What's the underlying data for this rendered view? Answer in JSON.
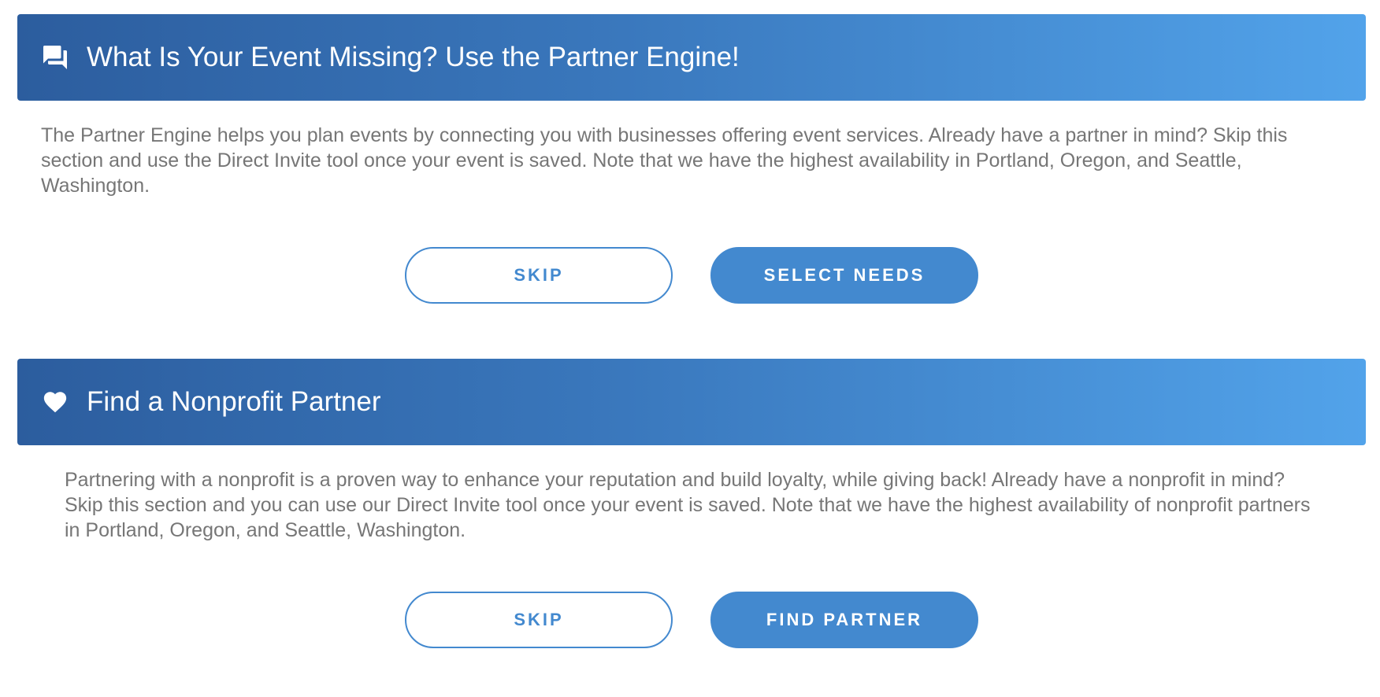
{
  "sections": [
    {
      "icon": "chat-bubbles-icon",
      "title": "What Is Your Event Missing? Use the Partner Engine!",
      "description": "The Partner Engine helps you plan events by connecting you with businesses offering event services. Already have a partner in mind? Skip this section and use the Direct Invite tool once your event is saved. Note that we have the highest availability in Portland, Oregon, and Seattle, Washington.",
      "skip_label": "SKIP",
      "primary_label": "SELECT NEEDS"
    },
    {
      "icon": "heart-icon",
      "title": "Find a Nonprofit Partner",
      "description": "Partnering with a nonprofit is a proven way to enhance your reputation and build loyalty, while giving back! Already have a nonprofit in mind? Skip this section and you can use our Direct Invite tool once your event is saved. Note that we have the highest availability of nonprofit partners in Portland, Oregon, and Seattle, Washington.",
      "skip_label": "SKIP",
      "primary_label": "FIND PARTNER"
    }
  ],
  "colors": {
    "header_gradient_start": "#2c5d9e",
    "header_gradient_end": "#52a3ea",
    "button_accent": "#4389cf",
    "body_text": "#767676"
  }
}
